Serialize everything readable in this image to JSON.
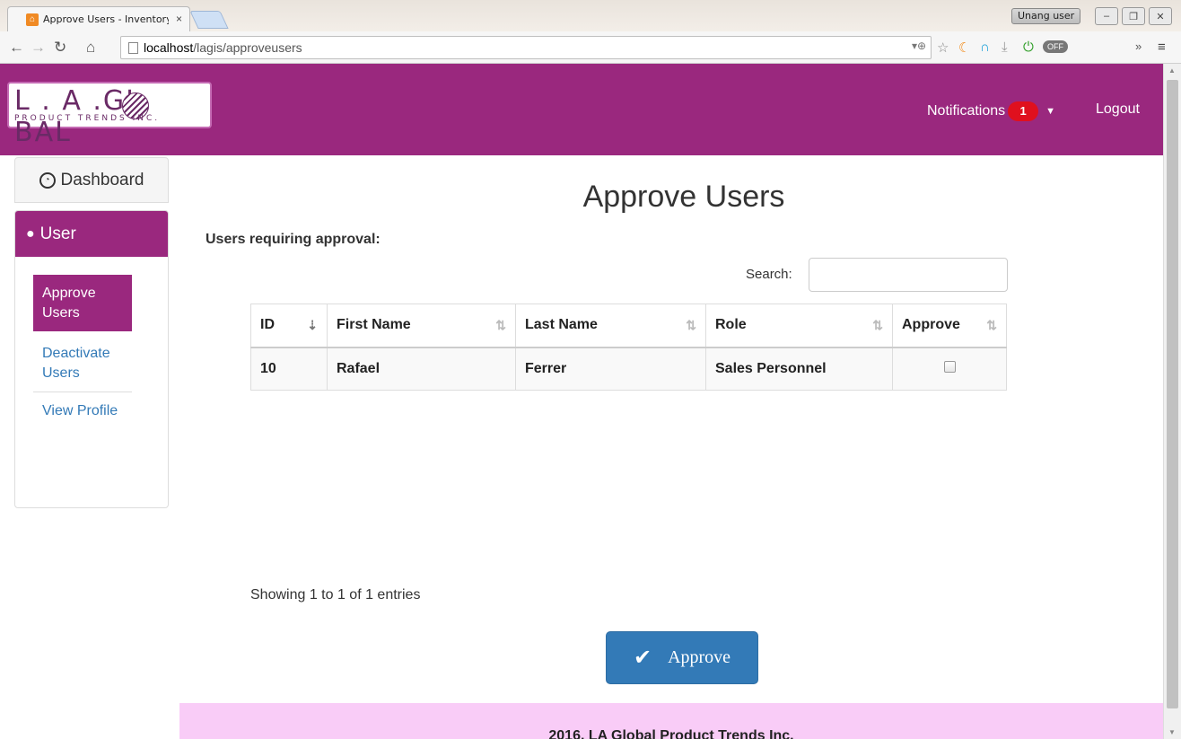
{
  "browser": {
    "tab_title": "Approve Users - Inventory",
    "tab_close": "×",
    "user_badge": "Unang user",
    "url_host": "localhost",
    "url_path": "/lagis/approveusers",
    "ext_off": "OFF"
  },
  "header": {
    "logo_big": "L . A .GL  BAL",
    "logo_sub": "PRODUCT TRENDS INC.",
    "notifications_label": "Notifications",
    "notifications_count": "1",
    "logout_label": "Logout"
  },
  "sidebar": {
    "dashboard_label": "Dashboard",
    "section_label": "User",
    "items": [
      {
        "label": "Approve Users",
        "active": true
      },
      {
        "label": "Deactivate Users",
        "active": false
      },
      {
        "label": "View Profile",
        "active": false
      }
    ]
  },
  "main": {
    "title": "Approve Users",
    "subheading": "Users requiring approval:",
    "search_label": "Search:",
    "search_value": "",
    "table": {
      "columns": [
        "ID",
        "First Name",
        "Last Name",
        "Role",
        "Approve"
      ],
      "rows": [
        {
          "id": "10",
          "first_name": "Rafael",
          "last_name": "Ferrer",
          "role": "Sales Personnel",
          "approve": false
        }
      ]
    },
    "info": "Showing 1 to 1 of 1 entries",
    "approve_button": "Approve"
  },
  "footer": {
    "text": "2016, LA Global Product Trends Inc."
  },
  "colors": {
    "brand": "#9a287e",
    "footer_bg": "#f9ccf7",
    "button": "#337ab7"
  }
}
